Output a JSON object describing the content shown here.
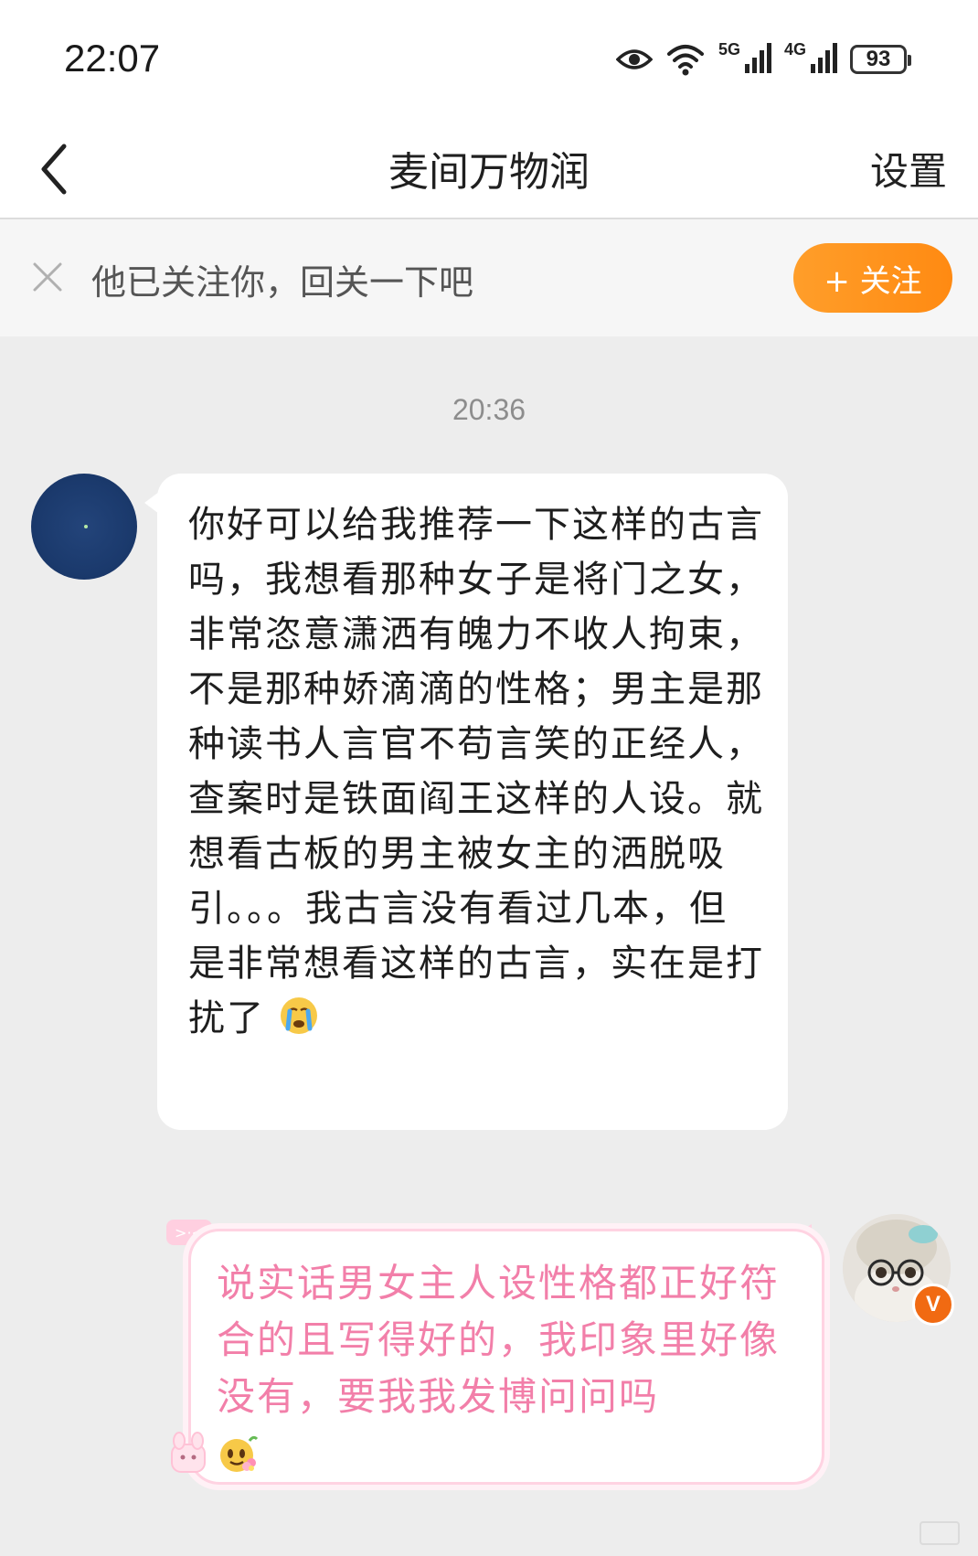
{
  "status_bar": {
    "time": "22:07",
    "network_5g": "5G",
    "network_4g": "4G",
    "battery": "93"
  },
  "nav": {
    "title": "麦间万物润",
    "settings": "设置"
  },
  "follow_bar": {
    "text": "他已关注你，回关一下吧",
    "button": "+ 关注"
  },
  "chat": {
    "timestamp": "20:36",
    "messages": [
      {
        "side": "left",
        "text": "你好可以给我推荐一下这样的古言吗，我想看那种女子是将门之女，非常恣意潇洒有魄力不收人拘束，不是那种娇滴滴的性格；男主是那种读书人言官不苟言笑的正经人，查案时是铁面阎王这样的人设。就想看古板的男主被女主的洒脱吸引。。。我古言没有看过几本，但是非常想看这样的古言，实在是打扰了",
        "emoji": "crying-face"
      },
      {
        "side": "right",
        "text": "说实话男女主人设性格都正好符合的且写得好的，我印象里好像没有，要我我发博问问吗",
        "emoji": "flower-face"
      }
    ],
    "vip_badge": "V"
  },
  "colors": {
    "follow_button": "#ff9118",
    "right_bubble_text": "#f27fa9",
    "right_bubble_border": "#ffd3e2"
  }
}
